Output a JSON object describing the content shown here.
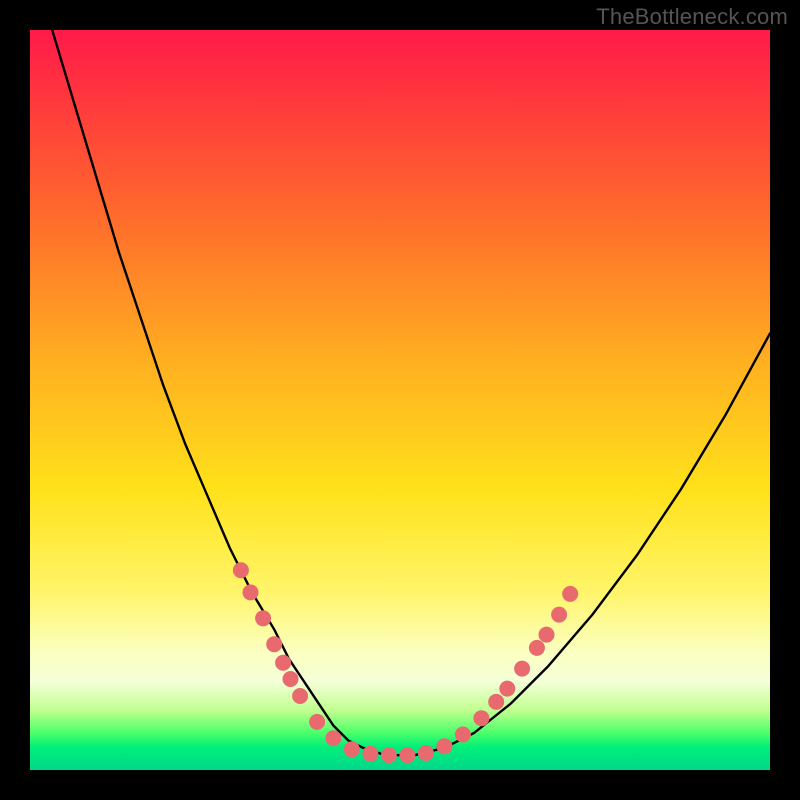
{
  "watermark": "TheBottleneck.com",
  "chart_data": {
    "type": "line",
    "title": "",
    "xlabel": "",
    "ylabel": "",
    "xlim": [
      0,
      100
    ],
    "ylim": [
      0,
      100
    ],
    "series": [
      {
        "name": "bottleneck-curve",
        "x": [
          3,
          6,
          9,
          12,
          15,
          18,
          21,
          24,
          27,
          30,
          33,
          35,
          37,
          39,
          41,
          43,
          45,
          48,
          52,
          56,
          60,
          65,
          70,
          76,
          82,
          88,
          94,
          100
        ],
        "y": [
          100,
          90,
          80,
          70,
          61,
          52,
          44,
          37,
          30,
          24,
          19,
          15,
          12,
          9,
          6,
          4,
          3,
          2,
          2,
          3,
          5,
          9,
          14,
          21,
          29,
          38,
          48,
          59
        ]
      }
    ],
    "markers": {
      "name": "highlight-points",
      "color": "#e86a6e",
      "points": [
        {
          "x": 28.5,
          "y": 27.0
        },
        {
          "x": 29.8,
          "y": 24.0
        },
        {
          "x": 31.5,
          "y": 20.5
        },
        {
          "x": 33.0,
          "y": 17.0
        },
        {
          "x": 34.2,
          "y": 14.5
        },
        {
          "x": 35.2,
          "y": 12.3
        },
        {
          "x": 36.5,
          "y": 10.0
        },
        {
          "x": 38.8,
          "y": 6.5
        },
        {
          "x": 41.0,
          "y": 4.3
        },
        {
          "x": 43.5,
          "y": 2.8
        },
        {
          "x": 46.0,
          "y": 2.2
        },
        {
          "x": 48.5,
          "y": 2.0
        },
        {
          "x": 51.0,
          "y": 2.0
        },
        {
          "x": 53.5,
          "y": 2.3
        },
        {
          "x": 56.0,
          "y": 3.2
        },
        {
          "x": 58.5,
          "y": 4.8
        },
        {
          "x": 61.0,
          "y": 7.0
        },
        {
          "x": 63.0,
          "y": 9.2
        },
        {
          "x": 64.5,
          "y": 11.0
        },
        {
          "x": 66.5,
          "y": 13.7
        },
        {
          "x": 68.5,
          "y": 16.5
        },
        {
          "x": 69.8,
          "y": 18.3
        },
        {
          "x": 71.5,
          "y": 21.0
        },
        {
          "x": 73.0,
          "y": 23.8
        }
      ]
    }
  }
}
